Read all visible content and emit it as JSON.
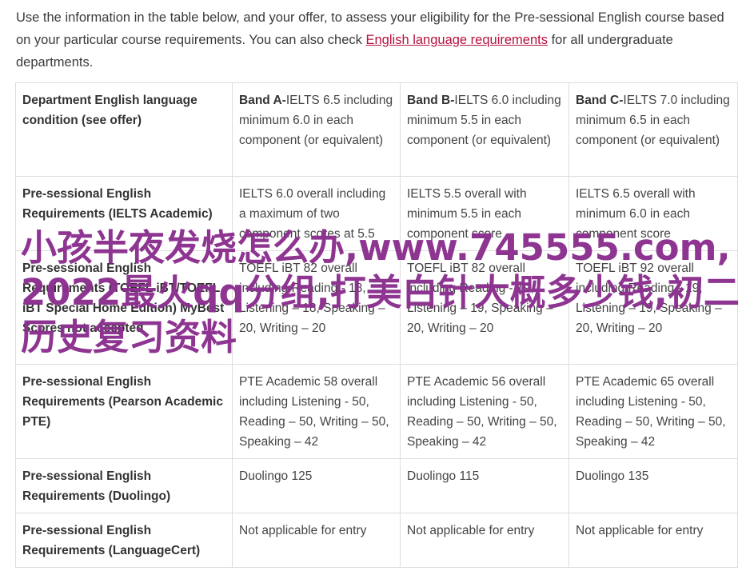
{
  "intro": {
    "text_before": "Use the information in the table below, and your offer, to assess your eligibility for the Pre-sessional English course based on your particular course requirements. You can also check ",
    "link_text": "English language requirements",
    "text_after": " for all undergraduate departments."
  },
  "table": {
    "header": {
      "label": "Department English language condition (see offer)",
      "bands": [
        {
          "name": "Band A-",
          "detail": "IELTS 6.5 including minimum 6.0 in each component (or equivalent)"
        },
        {
          "name": "Band B-",
          "detail": "IELTS 6.0 including minimum 5.5 in each component (or equivalent)"
        },
        {
          "name": "Band C-",
          "detail": "IELTS 7.0 including minimum 6.5 in each component (or equivalent)"
        }
      ]
    },
    "rows": [
      {
        "label": "Pre-sessional English Requirements (IELTS Academic)",
        "cells": [
          "IELTS 6.0 overall including a maximum of two component scores at 5.5",
          "IELTS 5.5 overall with minimum 5.5 in each component score",
          "IELTS 6.5 overall with minimum 6.0 in each component score"
        ]
      },
      {
        "label": "Pre-sessional English Requirements (TOEFL iBT/TOEFL iBT Special Home Edition) MyBest Scores not accepted",
        "cells": [
          "TOEFL iBT 82 overall including Reading - 18, Listening – 18, Speaking – 20, Writing – 20",
          "TOEFL iBT 82 overall including Reading - 19, Listening – 19, Speaking – 20, Writing – 20",
          "TOEFL iBT 92 overall including Reading - 19, Listening – 19, Speaking – 20, Writing – 20"
        ]
      },
      {
        "label": "Pre-sessional English Requirements (Pearson Academic PTE)",
        "cells": [
          "PTE Academic 58 overall including Listening - 50, Reading – 50, Writing – 50, Speaking – 42",
          "PTE Academic 56 overall including Listening - 50, Reading – 50, Writing – 50, Speaking – 42",
          "PTE Academic 65 overall including Listening - 50, Reading – 50, Writing – 50, Speaking – 42"
        ]
      },
      {
        "label": "Pre-sessional English Requirements (Duolingo)",
        "cells": [
          "Duolingo 125",
          "Duolingo 115",
          "Duolingo 135"
        ]
      },
      {
        "label": "Pre-sessional English Requirements (LanguageCert)",
        "cells": [
          "Not applicable for entry",
          "Not applicable for entry",
          "Not applicable for entry"
        ]
      }
    ]
  },
  "overlay_text": "小孩半夜发烧怎么办,www.745555.com,2022最火qq分组,打美白针大概多少钱,初二历史复习资料",
  "colors": {
    "link": "#b5123e",
    "overlay": "#8b2f8f",
    "border": "#dddddd"
  }
}
